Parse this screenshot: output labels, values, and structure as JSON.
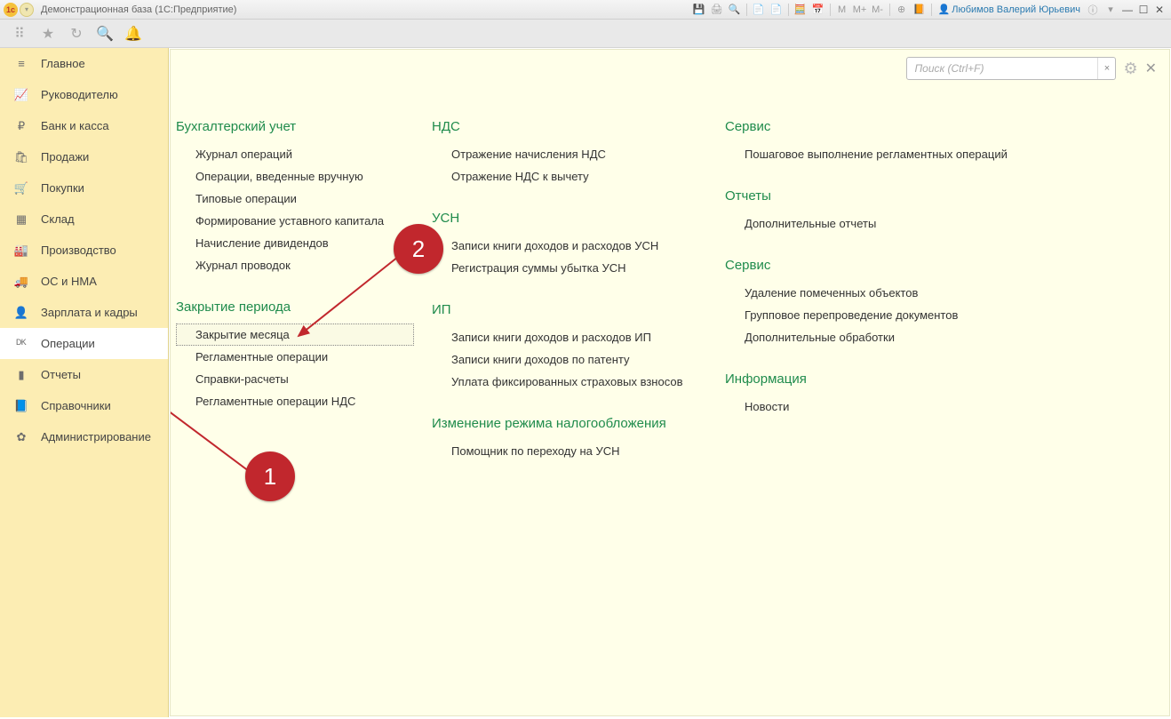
{
  "window": {
    "title": "Демонстрационная база  (1С:Предприятие)",
    "user": "Любимов Валерий Юрьевич",
    "title_m": "M",
    "title_mplus": "M+",
    "title_mminus": "M-"
  },
  "search": {
    "placeholder": "Поиск (Ctrl+F)",
    "clear": "×"
  },
  "sidebar": {
    "items": [
      {
        "icon": "≡",
        "label": "Главное"
      },
      {
        "icon": "📈",
        "label": "Руководителю"
      },
      {
        "icon": "₽",
        "label": "Банк и касса"
      },
      {
        "icon": "🛍",
        "label": "Продажи"
      },
      {
        "icon": "🛒",
        "label": "Покупки"
      },
      {
        "icon": "▦",
        "label": "Склад"
      },
      {
        "icon": "🏭",
        "label": "Производство"
      },
      {
        "icon": "🚚",
        "label": "ОС и НМА"
      },
      {
        "icon": "👤",
        "label": "Зарплата и кадры"
      },
      {
        "icon": "ᴰᴷ",
        "label": "Операции"
      },
      {
        "icon": "▮",
        "label": "Отчеты"
      },
      {
        "icon": "📘",
        "label": "Справочники"
      },
      {
        "icon": "✿",
        "label": "Администрирование"
      }
    ]
  },
  "col1": {
    "g1": {
      "title": "Бухгалтерский учет",
      "links": [
        "Журнал операций",
        "Операции, введенные вручную",
        "Типовые операции",
        "Формирование уставного капитала",
        "Начисление дивидендов",
        "Журнал проводок"
      ]
    },
    "g2": {
      "title": "Закрытие периода",
      "links": [
        "Закрытие месяца",
        "Регламентные операции",
        "Справки-расчеты",
        "Регламентные операции НДС"
      ]
    }
  },
  "col2": {
    "g1": {
      "title": "НДС",
      "links": [
        "Отражение начисления НДС",
        "Отражение НДС к вычету"
      ]
    },
    "g2": {
      "title": "УСН",
      "links": [
        "Записи книги доходов и расходов УСН",
        "Регистрация суммы убытка УСН"
      ]
    },
    "g3": {
      "title": "ИП",
      "links": [
        "Записи книги доходов и расходов ИП",
        "Записи книги доходов по патенту",
        "Уплата фиксированных страховых взносов"
      ]
    },
    "g4": {
      "title": "Изменение режима налогообложения",
      "links": [
        "Помощник по переходу на УСН"
      ]
    }
  },
  "col3": {
    "g1": {
      "title": "Сервис",
      "links": [
        "Пошаговое выполнение регламентных операций"
      ]
    },
    "g2": {
      "title": "Отчеты",
      "links": [
        "Дополнительные отчеты"
      ]
    },
    "g3": {
      "title": "Сервис",
      "links": [
        "Удаление помеченных объектов",
        "Групповое перепроведение документов",
        "Дополнительные обработки"
      ]
    },
    "g4": {
      "title": "Информация",
      "links": [
        "Новости"
      ]
    }
  },
  "annotations": {
    "b1": "1",
    "b2": "2"
  }
}
